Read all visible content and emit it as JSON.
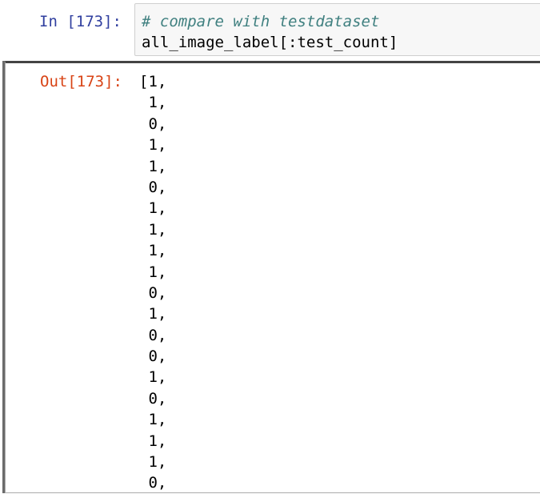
{
  "input_cell": {
    "prompt": "In [173]:",
    "lines": [
      "# compare with testdataset",
      "all_image_label[:test_count]"
    ]
  },
  "output_cell": {
    "prompt": "Out[173]:",
    "lines": [
      "[1,",
      " 1,",
      " 0,",
      " 1,",
      " 1,",
      " 0,",
      " 1,",
      " 1,",
      " 1,",
      " 1,",
      " 0,",
      " 1,",
      " 0,",
      " 0,",
      " 1,",
      " 0,",
      " 1,",
      " 1,",
      " 1,",
      " 0,"
    ]
  }
}
